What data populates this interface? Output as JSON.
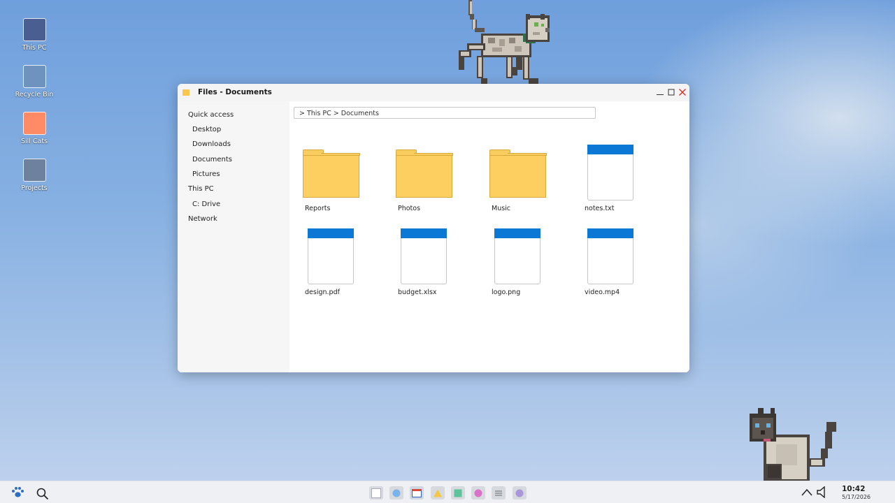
{
  "desktop": {
    "icons": [
      {
        "label": "This PC",
        "color": "#4a5e91"
      },
      {
        "label": "Recycle Bin",
        "color": "#6f93bf"
      },
      {
        "label": "Sill Cats",
        "color": "#fe8a66"
      },
      {
        "label": "Projects",
        "color": "#6e829e"
      }
    ]
  },
  "window": {
    "title": "Files - Documents",
    "sidebar": {
      "items": [
        {
          "label": "Quick access",
          "level": 0
        },
        {
          "label": "Desktop",
          "level": 1
        },
        {
          "label": "Downloads",
          "level": 1
        },
        {
          "label": "Documents",
          "level": 1
        },
        {
          "label": "Pictures",
          "level": 1
        },
        {
          "label": "This PC",
          "level": 0
        },
        {
          "label": "C: Drive",
          "level": 1
        },
        {
          "label": "Network",
          "level": 0
        }
      ]
    },
    "path": "> This PC > Documents",
    "items": [
      {
        "name": "Reports",
        "kind": "folder"
      },
      {
        "name": "Photos",
        "kind": "folder"
      },
      {
        "name": "Music",
        "kind": "folder"
      },
      {
        "name": "notes.txt",
        "kind": "file"
      },
      {
        "name": "design.pdf",
        "kind": "file"
      },
      {
        "name": "budget.xlsx",
        "kind": "file"
      },
      {
        "name": "logo.png",
        "kind": "file"
      },
      {
        "name": "video.mp4",
        "kind": "file"
      }
    ]
  },
  "taskbar": {
    "apps": [
      {
        "icon": "window-app-icon"
      },
      {
        "icon": "blue-circle-app-icon"
      },
      {
        "icon": "calendar-app-icon",
        "active": true
      },
      {
        "icon": "yellow-triangle-app-icon"
      },
      {
        "icon": "green-square-app-icon"
      },
      {
        "icon": "pink-circle-app-icon"
      },
      {
        "icon": "notes-app-icon"
      },
      {
        "icon": "purple-circle-app-icon"
      }
    ],
    "time": "10:42",
    "date": "5/17/2026"
  },
  "colors": {
    "accent": "#0a78d4",
    "folder": "#fdcf60",
    "close": "#d0312d"
  }
}
